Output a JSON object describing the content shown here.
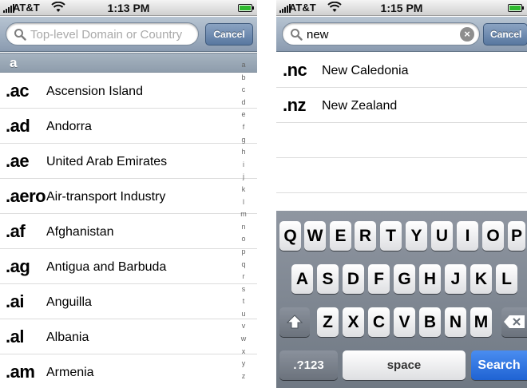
{
  "left": {
    "status": {
      "carrier": "AT&T",
      "time": "1:13 PM"
    },
    "search": {
      "placeholder": "Top-level Domain or Country",
      "value": "",
      "cancel_label": "Cancel"
    },
    "section_header": "a",
    "rows": [
      {
        "tld": ".ac",
        "country": "Ascension Island"
      },
      {
        "tld": ".ad",
        "country": "Andorra"
      },
      {
        "tld": ".ae",
        "country": "United Arab Emirates"
      },
      {
        "tld": ".aero",
        "country": "Air-transport Industry"
      },
      {
        "tld": ".af",
        "country": "Afghanistan"
      },
      {
        "tld": ".ag",
        "country": "Antigua and Barbuda"
      },
      {
        "tld": ".ai",
        "country": "Anguilla"
      },
      {
        "tld": ".al",
        "country": "Albania"
      },
      {
        "tld": ".am",
        "country": "Armenia"
      }
    ],
    "index_letters": [
      "a",
      "b",
      "c",
      "d",
      "e",
      "f",
      "g",
      "h",
      "i",
      "j",
      "k",
      "l",
      "m",
      "n",
      "o",
      "p",
      "q",
      "r",
      "s",
      "t",
      "u",
      "v",
      "w",
      "x",
      "y",
      "z"
    ]
  },
  "right": {
    "status": {
      "carrier": "AT&T",
      "time": "1:15 PM"
    },
    "search": {
      "placeholder": "",
      "value": "new",
      "cancel_label": "Cancel",
      "clear_glyph": "×"
    },
    "rows": [
      {
        "tld": ".nc",
        "country": "New Caledonia"
      },
      {
        "tld": ".nz",
        "country": "New Zealand"
      }
    ],
    "empty_rows": 2,
    "keyboard": {
      "row1": [
        "Q",
        "W",
        "E",
        "R",
        "T",
        "Y",
        "U",
        "I",
        "O",
        "P"
      ],
      "row2": [
        "A",
        "S",
        "D",
        "F",
        "G",
        "H",
        "J",
        "K",
        "L"
      ],
      "row3": [
        "Z",
        "X",
        "C",
        "V",
        "B",
        "N",
        "M"
      ],
      "shift_icon": "shift-arrow-icon",
      "delete_icon": "backspace-icon",
      "numbers_label": ".?123",
      "space_label": "space",
      "search_label": "Search"
    }
  },
  "colors": {
    "bar_top": "#b7c4d2",
    "bar_bottom": "#8a9bb0",
    "search_key": "#1f63d3",
    "battery": "#2eb82e"
  }
}
